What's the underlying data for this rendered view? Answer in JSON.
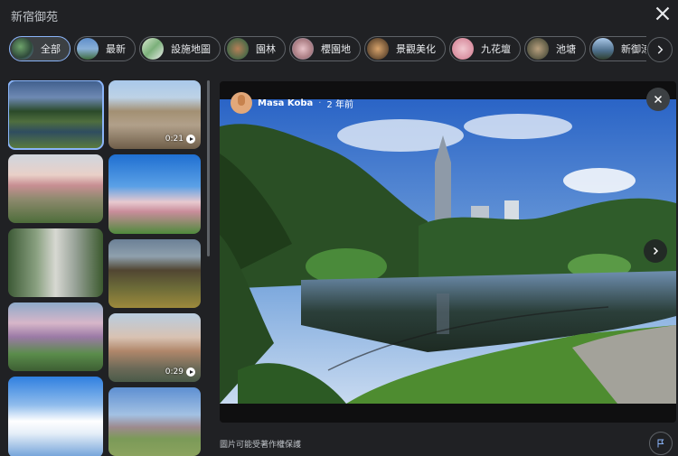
{
  "header": {
    "title": "新宿御苑"
  },
  "chips": [
    {
      "label": "全部",
      "active": true
    },
    {
      "label": "最新"
    },
    {
      "label": "設施地圖"
    },
    {
      "label": "園林"
    },
    {
      "label": "櫻園地"
    },
    {
      "label": "景觀美化"
    },
    {
      "label": "九花壇"
    },
    {
      "label": "池塘"
    },
    {
      "label": "新御涼亭（舊"
    }
  ],
  "grid": {
    "tiles": [
      {
        "name": "lake-photo",
        "selected": true
      },
      {
        "name": "garden-video",
        "duration": "0:21"
      },
      {
        "name": "cherry-pond-photo"
      },
      {
        "name": "tower-sky-photo"
      },
      {
        "name": "gate-photo"
      },
      {
        "name": "big-tree-photo"
      },
      {
        "name": "pink-blossom-photo"
      },
      {
        "name": "autumn-video",
        "duration": "0:29"
      },
      {
        "name": "cloud-sky-photo"
      },
      {
        "name": "lawn-tower-photo"
      }
    ]
  },
  "viewer": {
    "author": "Masa Koba",
    "separator": "·",
    "time_ago": "2 年前"
  },
  "footer": {
    "copyright_note": "圖片可能受著作權保護"
  },
  "colors": {
    "accent": "#8ab4f8",
    "background": "#202124"
  }
}
